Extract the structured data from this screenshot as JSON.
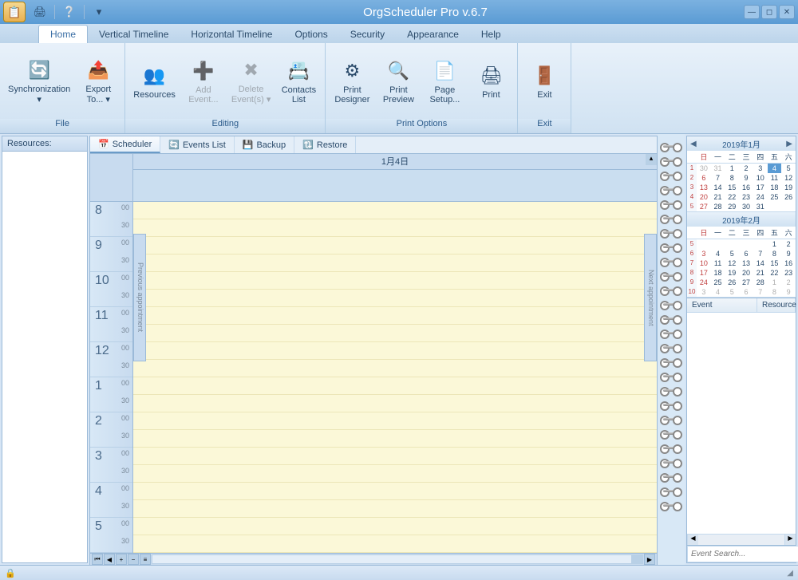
{
  "title": "OrgScheduler Pro v.6.7",
  "menutabs": [
    "Home",
    "Vertical Timeline",
    "Horizontal Timeline",
    "Options",
    "Security",
    "Appearance",
    "Help"
  ],
  "activeMenuTab": 0,
  "ribbon": {
    "groups": [
      {
        "label": "File",
        "buttons": [
          {
            "label": "Synchronization ▾",
            "icon": "🔄"
          },
          {
            "label": "Export To... ▾",
            "icon": "📤"
          }
        ]
      },
      {
        "label": "Editing",
        "buttons": [
          {
            "label": "Resources",
            "icon": "👥"
          },
          {
            "label": "Add Event...",
            "icon": "➕",
            "disabled": true
          },
          {
            "label": "Delete Event(s) ▾",
            "icon": "✖",
            "disabled": true
          },
          {
            "label": "Contacts List",
            "icon": "📇"
          }
        ]
      },
      {
        "label": "Print Options",
        "buttons": [
          {
            "label": "Print Designer",
            "icon": "⚙"
          },
          {
            "label": "Print Preview",
            "icon": "🔍"
          },
          {
            "label": "Page Setup...",
            "icon": "📄"
          },
          {
            "label": "Print",
            "icon": "🖨"
          }
        ]
      },
      {
        "label": "Exit",
        "buttons": [
          {
            "label": "Exit",
            "icon": "🚪"
          }
        ]
      }
    ]
  },
  "leftPanel": {
    "title": "Resources:"
  },
  "subtabs": [
    {
      "label": "Scheduler",
      "icon": "📅"
    },
    {
      "label": "Events List",
      "icon": "🔄"
    },
    {
      "label": "Backup",
      "icon": "💾"
    },
    {
      "label": "Restore",
      "icon": "🔃"
    }
  ],
  "activeSubtab": 0,
  "scheduler": {
    "dateHeader": "1月4日",
    "hours": [
      "8",
      "9",
      "10",
      "11",
      "12",
      "1",
      "2",
      "3",
      "4",
      "5"
    ],
    "min00": "00",
    "min30": "30",
    "prevApt": "Previous appointment",
    "nextApt": "Next appointment"
  },
  "calendars": [
    {
      "title": "2019年1月",
      "dow": [
        "日",
        "一",
        "二",
        "三",
        "四",
        "五",
        "六"
      ],
      "weeks": [
        {
          "wk": "1",
          "days": [
            {
              "d": "30",
              "o": true
            },
            {
              "d": "31",
              "o": true
            },
            {
              "d": "1"
            },
            {
              "d": "2"
            },
            {
              "d": "3"
            },
            {
              "d": "4",
              "today": true
            },
            {
              "d": "5"
            }
          ]
        },
        {
          "wk": "2",
          "days": [
            {
              "d": "6",
              "sun": true
            },
            {
              "d": "7"
            },
            {
              "d": "8"
            },
            {
              "d": "9"
            },
            {
              "d": "10"
            },
            {
              "d": "11"
            },
            {
              "d": "12"
            }
          ]
        },
        {
          "wk": "3",
          "days": [
            {
              "d": "13",
              "sun": true
            },
            {
              "d": "14"
            },
            {
              "d": "15"
            },
            {
              "d": "16"
            },
            {
              "d": "17"
            },
            {
              "d": "18"
            },
            {
              "d": "19"
            }
          ]
        },
        {
          "wk": "4",
          "days": [
            {
              "d": "20",
              "sun": true
            },
            {
              "d": "21"
            },
            {
              "d": "22"
            },
            {
              "d": "23"
            },
            {
              "d": "24"
            },
            {
              "d": "25"
            },
            {
              "d": "26"
            }
          ]
        },
        {
          "wk": "5",
          "days": [
            {
              "d": "27",
              "sun": true
            },
            {
              "d": "28"
            },
            {
              "d": "29"
            },
            {
              "d": "30"
            },
            {
              "d": "31"
            },
            {
              "d": ""
            },
            {
              "d": ""
            }
          ]
        }
      ]
    },
    {
      "title": "2019年2月",
      "dow": [
        "日",
        "一",
        "二",
        "三",
        "四",
        "五",
        "六"
      ],
      "weeks": [
        {
          "wk": "5",
          "days": [
            {
              "d": ""
            },
            {
              "d": ""
            },
            {
              "d": ""
            },
            {
              "d": ""
            },
            {
              "d": ""
            },
            {
              "d": "1"
            },
            {
              "d": "2"
            }
          ]
        },
        {
          "wk": "6",
          "days": [
            {
              "d": "3",
              "sun": true
            },
            {
              "d": "4"
            },
            {
              "d": "5"
            },
            {
              "d": "6"
            },
            {
              "d": "7"
            },
            {
              "d": "8"
            },
            {
              "d": "9"
            }
          ]
        },
        {
          "wk": "7",
          "days": [
            {
              "d": "10",
              "sun": true
            },
            {
              "d": "11"
            },
            {
              "d": "12"
            },
            {
              "d": "13"
            },
            {
              "d": "14"
            },
            {
              "d": "15"
            },
            {
              "d": "16"
            }
          ]
        },
        {
          "wk": "8",
          "days": [
            {
              "d": "17",
              "sun": true
            },
            {
              "d": "18"
            },
            {
              "d": "19"
            },
            {
              "d": "20"
            },
            {
              "d": "21"
            },
            {
              "d": "22"
            },
            {
              "d": "23"
            }
          ]
        },
        {
          "wk": "9",
          "days": [
            {
              "d": "24",
              "sun": true
            },
            {
              "d": "25"
            },
            {
              "d": "26"
            },
            {
              "d": "27"
            },
            {
              "d": "28"
            },
            {
              "d": "1",
              "o": true
            },
            {
              "d": "2",
              "o": true
            }
          ]
        },
        {
          "wk": "10",
          "days": [
            {
              "d": "3",
              "o": true
            },
            {
              "d": "4",
              "o": true
            },
            {
              "d": "5",
              "o": true
            },
            {
              "d": "6",
              "o": true
            },
            {
              "d": "7",
              "o": true
            },
            {
              "d": "8",
              "o": true
            },
            {
              "d": "9",
              "o": true
            }
          ]
        }
      ]
    }
  ],
  "eventList": {
    "cols": [
      "Event",
      "Resource"
    ]
  },
  "search": {
    "placeholder": "Event Search..."
  }
}
